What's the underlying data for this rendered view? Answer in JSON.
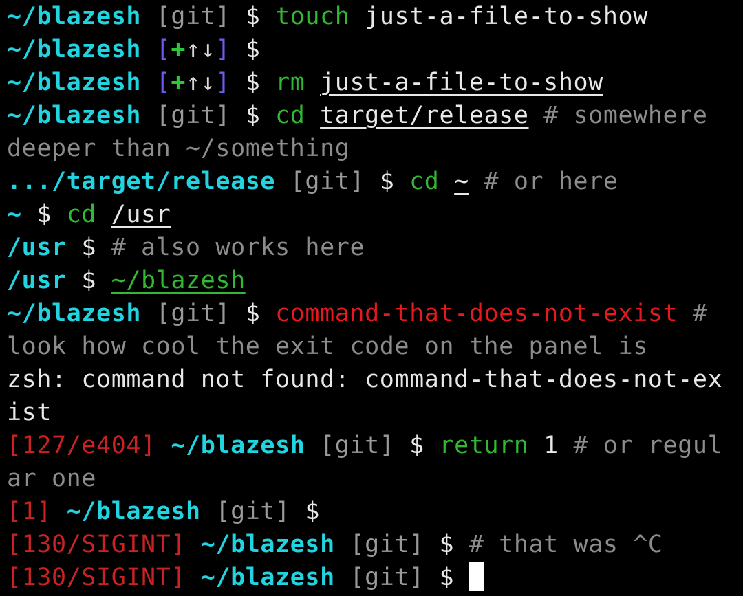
{
  "colors": {
    "background": "#000000",
    "text": "#e8e8e8",
    "path": "#22d3e0",
    "git": "#9a9a9a",
    "git_dirty_bracket": "#6a5cf0",
    "git_dirty_plus": "#2fc43a",
    "git_dirty_arrows": "#d8d8d8",
    "command": "#33b833",
    "comment": "#8c8c8c",
    "error": "#e5191e",
    "exit_code": "#c92222",
    "cursor": "#ffffff"
  },
  "lines": [
    {
      "segments": [
        {
          "text": "~/blazesh",
          "color": "path",
          "bold": true
        },
        {
          "text": " "
        },
        {
          "text": "[git]",
          "color": "git"
        },
        {
          "text": " $ "
        },
        {
          "text": "touch",
          "color": "command"
        },
        {
          "text": " just-a-file-to-show"
        }
      ]
    },
    {
      "segments": [
        {
          "text": "~/blazesh",
          "color": "path",
          "bold": true
        },
        {
          "text": " "
        },
        {
          "text": "[",
          "color": "git_dirty_bracket"
        },
        {
          "text": "+",
          "color": "git_dirty_plus",
          "bold": true
        },
        {
          "text": "↑↓",
          "color": "git_dirty_arrows"
        },
        {
          "text": "]",
          "color": "git_dirty_bracket"
        },
        {
          "text": " $"
        }
      ]
    },
    {
      "segments": [
        {
          "text": "~/blazesh",
          "color": "path",
          "bold": true
        },
        {
          "text": " "
        },
        {
          "text": "[",
          "color": "git_dirty_bracket"
        },
        {
          "text": "+",
          "color": "git_dirty_plus",
          "bold": true
        },
        {
          "text": "↑↓",
          "color": "git_dirty_arrows"
        },
        {
          "text": "]",
          "color": "git_dirty_bracket"
        },
        {
          "text": " $ "
        },
        {
          "text": "rm",
          "color": "command"
        },
        {
          "text": " "
        },
        {
          "text": "just-a-file-to-show",
          "underline": true
        }
      ]
    },
    {
      "segments": [
        {
          "text": "~/blazesh",
          "color": "path",
          "bold": true
        },
        {
          "text": " "
        },
        {
          "text": "[git]",
          "color": "git"
        },
        {
          "text": " $ "
        },
        {
          "text": "cd",
          "color": "command"
        },
        {
          "text": " "
        },
        {
          "text": "target/release",
          "underline": true
        },
        {
          "text": " # somewhere",
          "color": "comment"
        }
      ]
    },
    {
      "segments": [
        {
          "text": "deeper than ~/something",
          "color": "comment"
        }
      ]
    },
    {
      "segments": [
        {
          "text": ".../target/release",
          "color": "path",
          "bold": true
        },
        {
          "text": " "
        },
        {
          "text": "[git]",
          "color": "git"
        },
        {
          "text": " $ "
        },
        {
          "text": "cd",
          "color": "command"
        },
        {
          "text": " "
        },
        {
          "text": "~",
          "underline": true
        },
        {
          "text": " # or here",
          "color": "comment"
        }
      ]
    },
    {
      "segments": [
        {
          "text": "~",
          "color": "path",
          "bold": true
        },
        {
          "text": " $ "
        },
        {
          "text": "cd",
          "color": "command"
        },
        {
          "text": " "
        },
        {
          "text": "/usr",
          "underline": true
        }
      ]
    },
    {
      "segments": [
        {
          "text": "/usr",
          "color": "path",
          "bold": true
        },
        {
          "text": " $ "
        },
        {
          "text": "# also works here",
          "color": "comment"
        }
      ]
    },
    {
      "segments": [
        {
          "text": "/usr",
          "color": "path",
          "bold": true
        },
        {
          "text": " $ "
        },
        {
          "text": "~/blazesh",
          "color": "command",
          "underline": true
        }
      ]
    },
    {
      "segments": [
        {
          "text": "~/blazesh",
          "color": "path",
          "bold": true
        },
        {
          "text": " "
        },
        {
          "text": "[git]",
          "color": "git"
        },
        {
          "text": " $ "
        },
        {
          "text": "command-that-does-not-exist",
          "color": "error"
        },
        {
          "text": " #",
          "color": "comment"
        }
      ]
    },
    {
      "segments": [
        {
          "text": "look how cool the exit code on the panel is",
          "color": "comment"
        }
      ]
    },
    {
      "segments": [
        {
          "text": "zsh: command not found: command-that-does-not-ex"
        }
      ]
    },
    {
      "segments": [
        {
          "text": "ist"
        }
      ]
    },
    {
      "segments": [
        {
          "text": "[127/e404]",
          "color": "exit_code"
        },
        {
          "text": " "
        },
        {
          "text": "~/blazesh",
          "color": "path",
          "bold": true
        },
        {
          "text": " "
        },
        {
          "text": "[git]",
          "color": "git"
        },
        {
          "text": " $ "
        },
        {
          "text": "return",
          "color": "command"
        },
        {
          "text": " 1"
        },
        {
          "text": " # or regul",
          "color": "comment"
        }
      ]
    },
    {
      "segments": [
        {
          "text": "ar one",
          "color": "comment"
        }
      ]
    },
    {
      "segments": [
        {
          "text": "[1]",
          "color": "exit_code"
        },
        {
          "text": " "
        },
        {
          "text": "~/blazesh",
          "color": "path",
          "bold": true
        },
        {
          "text": " "
        },
        {
          "text": "[git]",
          "color": "git"
        },
        {
          "text": " $"
        }
      ]
    },
    {
      "segments": [
        {
          "text": "[130/SIGINT]",
          "color": "exit_code"
        },
        {
          "text": " "
        },
        {
          "text": "~/blazesh",
          "color": "path",
          "bold": true
        },
        {
          "text": " "
        },
        {
          "text": "[git]",
          "color": "git"
        },
        {
          "text": " $ "
        },
        {
          "text": "# that was ^C",
          "color": "comment"
        }
      ]
    },
    {
      "segments": [
        {
          "text": "[130/SIGINT]",
          "color": "exit_code"
        },
        {
          "text": " "
        },
        {
          "text": "~/blazesh",
          "color": "path",
          "bold": true
        },
        {
          "text": " "
        },
        {
          "text": "[git]",
          "color": "git"
        },
        {
          "text": " $ "
        }
      ],
      "cursor": true
    }
  ]
}
